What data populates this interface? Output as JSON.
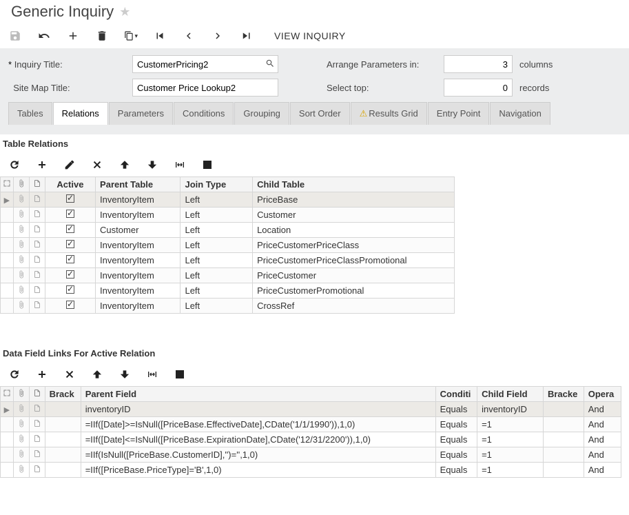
{
  "page": {
    "title": "Generic Inquiry"
  },
  "toolbar": {
    "view_inquiry": "VIEW INQUIRY"
  },
  "form": {
    "inquiry_title_label": "Inquiry Title:",
    "inquiry_title_value": "CustomerPricing2",
    "sitemap_title_label": "Site Map Title:",
    "sitemap_title_value": "Customer Price Lookup2",
    "arrange_label": "Arrange Parameters in:",
    "arrange_value": "3",
    "arrange_unit": "columns",
    "select_top_label": "Select top:",
    "select_top_value": "0",
    "select_top_unit": "records"
  },
  "tabs": [
    {
      "label": "Tables",
      "active": false
    },
    {
      "label": "Relations",
      "active": true
    },
    {
      "label": "Parameters",
      "active": false
    },
    {
      "label": "Conditions",
      "active": false
    },
    {
      "label": "Grouping",
      "active": false
    },
    {
      "label": "Sort Order",
      "active": false
    },
    {
      "label": "Results Grid",
      "active": false,
      "warn": true
    },
    {
      "label": "Entry Point",
      "active": false
    },
    {
      "label": "Navigation",
      "active": false
    }
  ],
  "relations": {
    "title": "Table Relations",
    "headers": {
      "active": "Active",
      "parent": "Parent Table",
      "join": "Join Type",
      "child": "Child Table"
    },
    "rows": [
      {
        "active": true,
        "parent": "InventoryItem",
        "join": "Left",
        "child": "PriceBase",
        "sel": true
      },
      {
        "active": true,
        "parent": "InventoryItem",
        "join": "Left",
        "child": "Customer"
      },
      {
        "active": true,
        "parent": "Customer",
        "join": "Left",
        "child": "Location"
      },
      {
        "active": true,
        "parent": "InventoryItem",
        "join": "Left",
        "child": "PriceCustomerPriceClass"
      },
      {
        "active": true,
        "parent": "InventoryItem",
        "join": "Left",
        "child": "PriceCustomerPriceClassPromotional"
      },
      {
        "active": true,
        "parent": "InventoryItem",
        "join": "Left",
        "child": "PriceCustomer"
      },
      {
        "active": true,
        "parent": "InventoryItem",
        "join": "Left",
        "child": "PriceCustomerPromotional"
      },
      {
        "active": true,
        "parent": "InventoryItem",
        "join": "Left",
        "child": "CrossRef"
      }
    ]
  },
  "links": {
    "title": "Data Field Links For Active Relation",
    "headers": {
      "brack": "Brack",
      "parentf": "Parent Field",
      "cond": "Conditi",
      "childf": "Child Field",
      "brack2": "Bracke",
      "oper": "Opera"
    },
    "rows": [
      {
        "brack": "",
        "parentf": "inventoryID",
        "cond": "Equals",
        "childf": "inventoryID",
        "brack2": "",
        "oper": "And",
        "sel": true
      },
      {
        "brack": "",
        "parentf": "=IIf([Date]>=IsNull([PriceBase.EffectiveDate],CDate('1/1/1990')),1,0)",
        "cond": "Equals",
        "childf": "=1",
        "brack2": "",
        "oper": "And"
      },
      {
        "brack": "",
        "parentf": "=IIf([Date]<=IsNull([PriceBase.ExpirationDate],CDate('12/31/2200')),1,0)",
        "cond": "Equals",
        "childf": "=1",
        "brack2": "",
        "oper": "And"
      },
      {
        "brack": "",
        "parentf": "=IIf(IsNull([PriceBase.CustomerID],'')='',1,0)",
        "cond": "Equals",
        "childf": "=1",
        "brack2": "",
        "oper": "And"
      },
      {
        "brack": "",
        "parentf": "=IIf([PriceBase.PriceType]='B',1,0)",
        "cond": "Equals",
        "childf": "=1",
        "brack2": "",
        "oper": "And"
      }
    ]
  }
}
